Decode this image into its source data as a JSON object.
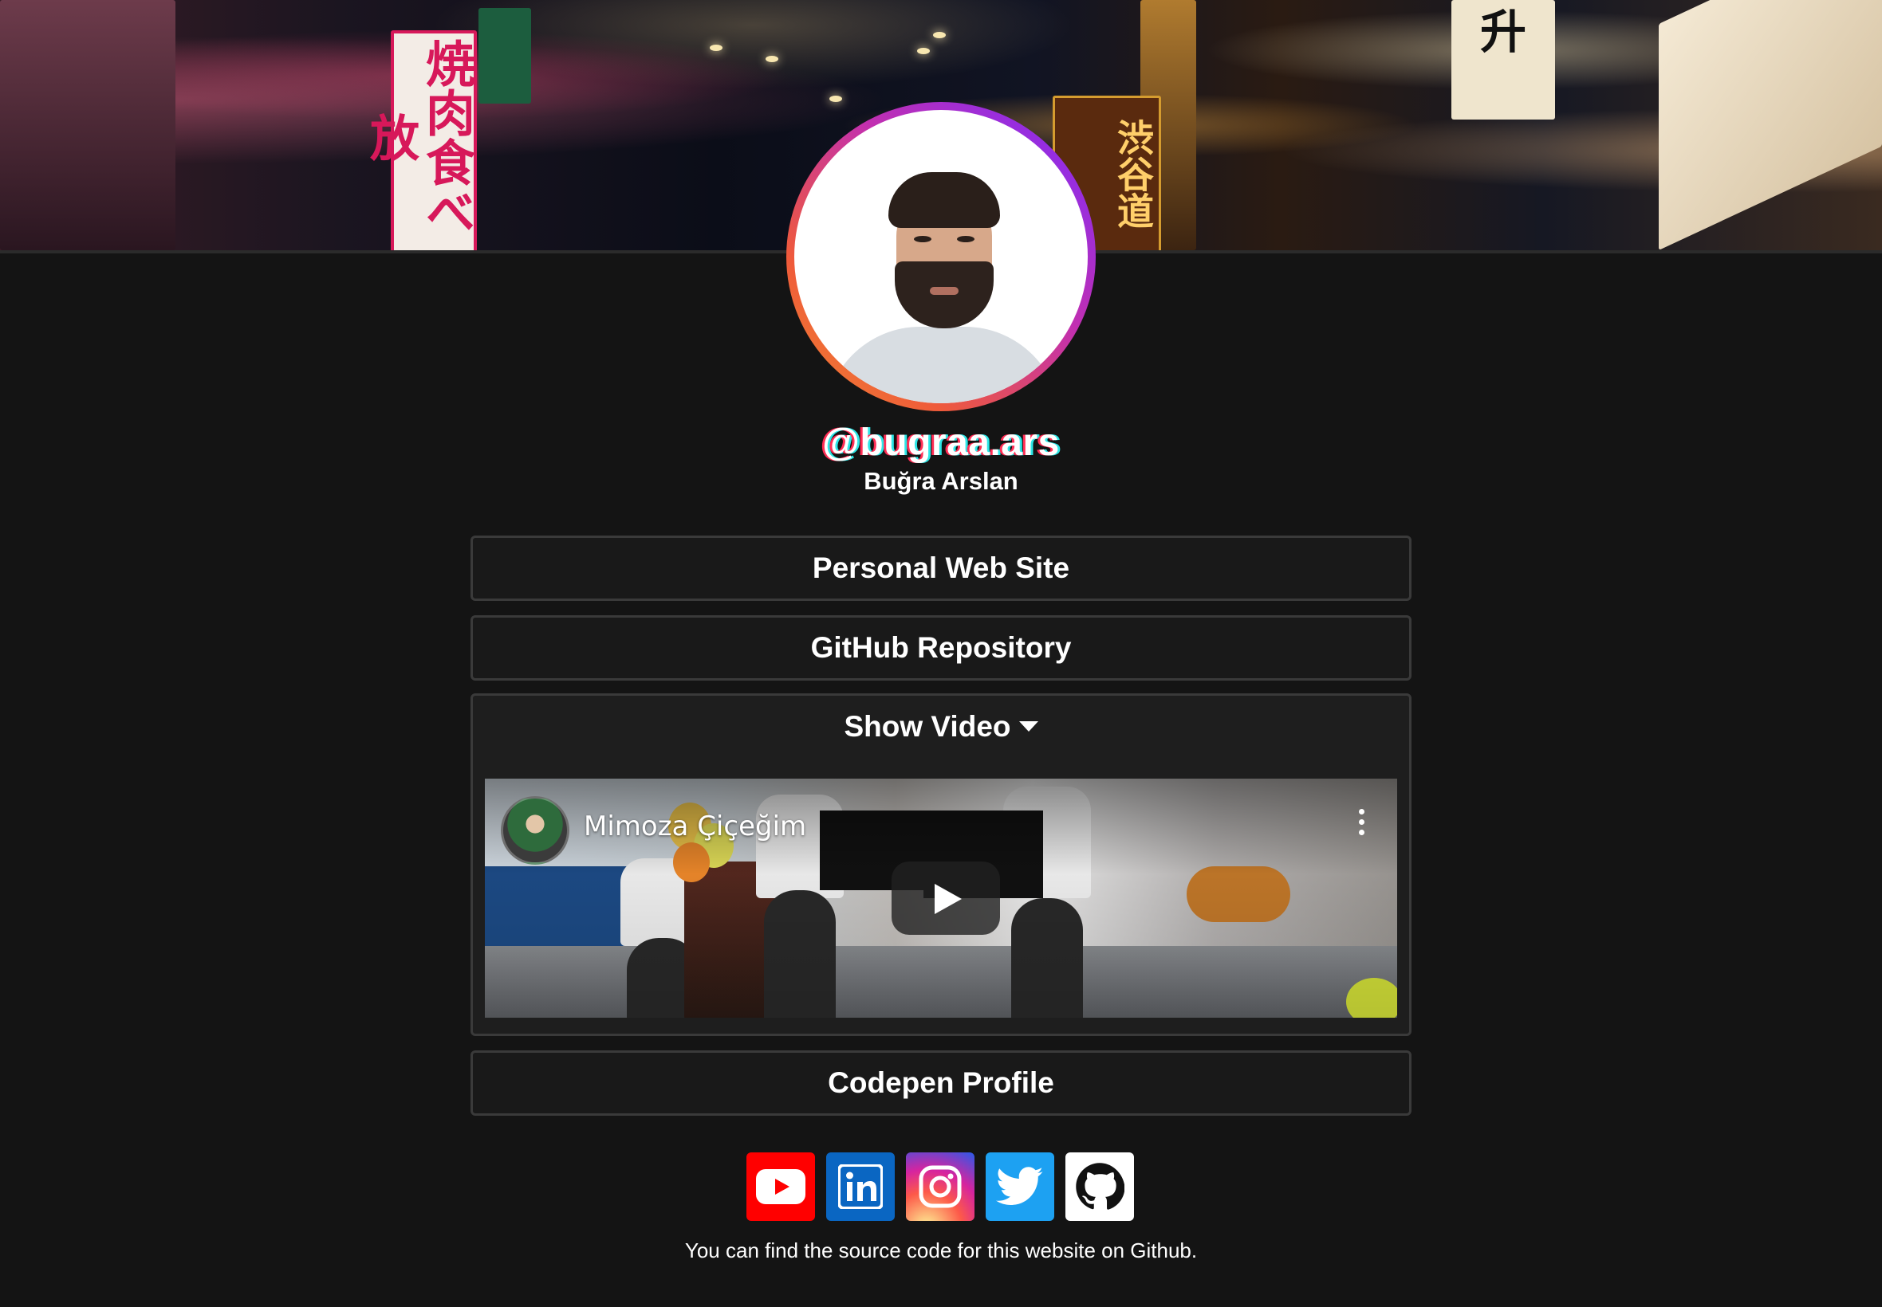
{
  "banner": {
    "signs": [
      "焼肉食べ放",
      "渋谷道",
      "升"
    ]
  },
  "profile": {
    "handle": "@bugraa.ars",
    "name": "Buğra Arslan"
  },
  "links": {
    "personal": "Personal Web Site",
    "github": "GitHub Repository",
    "video_toggle": "Show Video",
    "codepen": "Codepen Profile"
  },
  "video": {
    "title": "Mimoza Çiçeğim"
  },
  "socials": [
    {
      "icon": "youtube-icon",
      "color": "#ff0000"
    },
    {
      "icon": "linkedin-icon",
      "color": "#0a66c2"
    },
    {
      "icon": "instagram-icon",
      "color": "#d6249f"
    },
    {
      "icon": "twitter-icon",
      "color": "#1da1f2"
    },
    {
      "icon": "github-icon",
      "color": "#ffffff"
    }
  ],
  "footer": {
    "text": "You can find the source code for this website on Github."
  }
}
